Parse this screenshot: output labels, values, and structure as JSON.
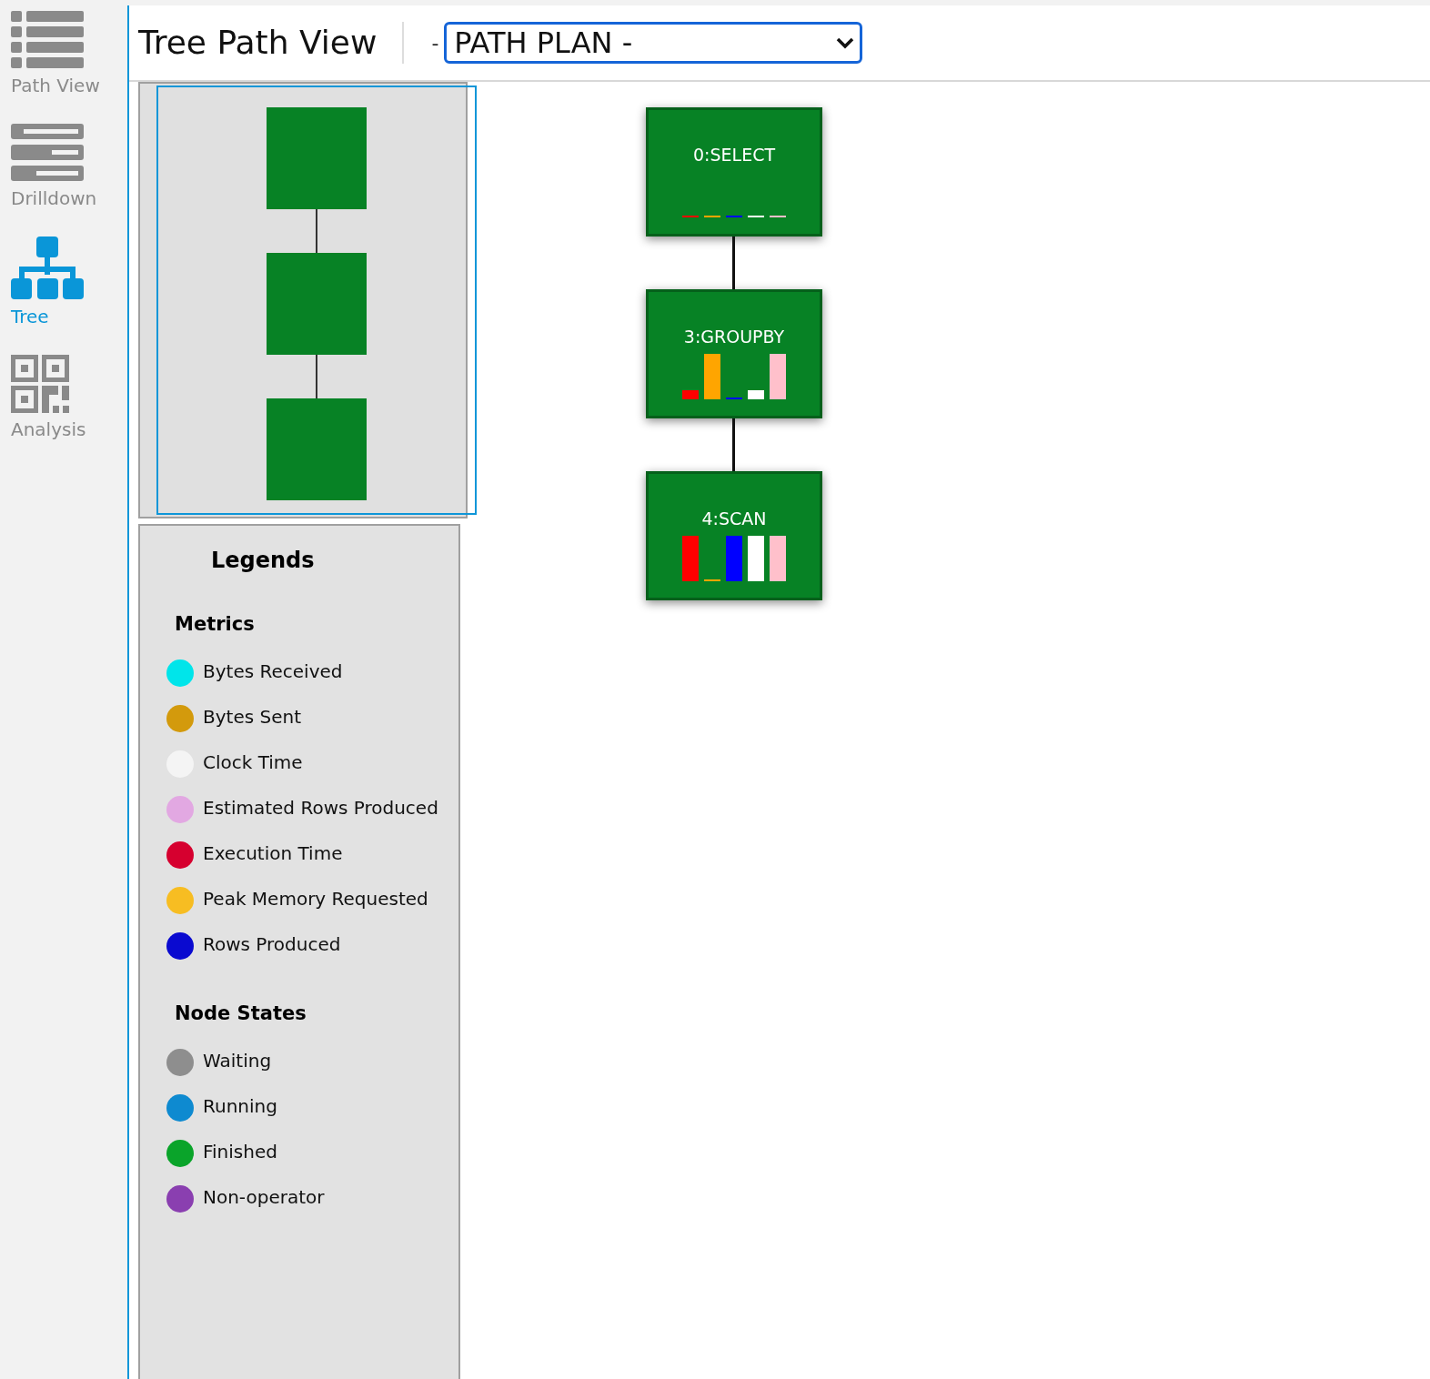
{
  "sidebar": {
    "items": [
      {
        "label": "Path View",
        "selected": false
      },
      {
        "label": "Drilldown",
        "selected": false
      },
      {
        "label": "Tree",
        "selected": true
      },
      {
        "label": "Analysis",
        "selected": false
      }
    ]
  },
  "header": {
    "title": "Tree Path View",
    "prefix": "-",
    "plan_select": {
      "value": "PATH PLAN -"
    }
  },
  "legends": {
    "title": "Legends",
    "sections": [
      {
        "heading": "Metrics",
        "items": [
          {
            "label": "Bytes Received",
            "color": "#00e5ea"
          },
          {
            "label": "Bytes Sent",
            "color": "#d39a0c"
          },
          {
            "label": "Clock Time",
            "color": "#f4f4f4"
          },
          {
            "label": "Estimated Rows Produced",
            "color": "#e2a8e2"
          },
          {
            "label": "Execution Time",
            "color": "#d6002f"
          },
          {
            "label": "Peak Memory Requested",
            "color": "#f7bd22"
          },
          {
            "label": "Rows Produced",
            "color": "#0a0ad0"
          }
        ]
      },
      {
        "heading": "Node States",
        "items": [
          {
            "label": "Waiting",
            "color": "#8e8e8e"
          },
          {
            "label": "Running",
            "color": "#0e8ad0"
          },
          {
            "label": "Finished",
            "color": "#0aa42a"
          },
          {
            "label": "Non-operator",
            "color": "#8a3fb0"
          }
        ]
      }
    ]
  },
  "tree": {
    "nodes": [
      {
        "label": "0:SELECT"
      },
      {
        "label": "3:GROUPBY"
      },
      {
        "label": "4:SCAN"
      }
    ]
  }
}
